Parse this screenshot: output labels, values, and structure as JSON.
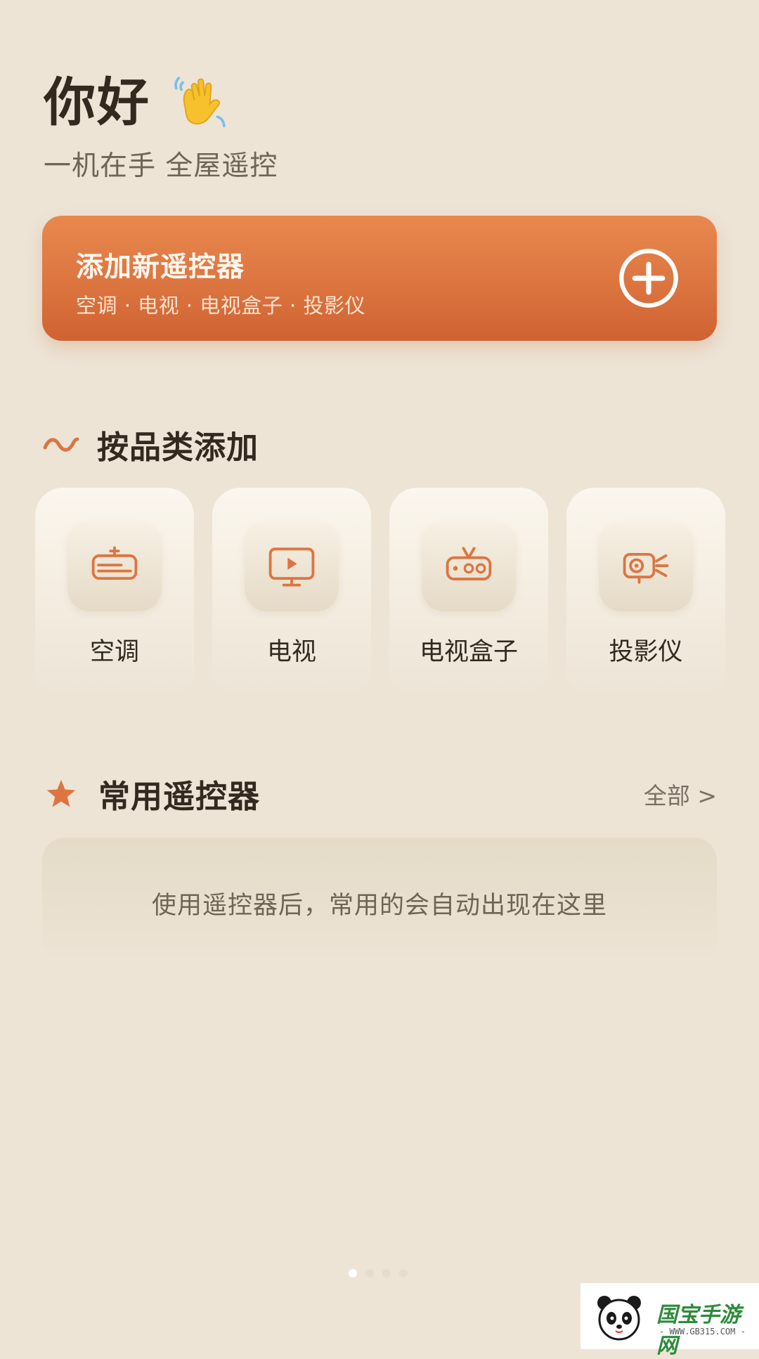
{
  "header": {
    "greeting": "你好",
    "greeting_icon": "waving-hand-icon",
    "subtitle": "一机在手 全屋遥控"
  },
  "add_card": {
    "title": "添加新遥控器",
    "subtitle": "空调 · 电视 · 电视盒子 · 投影仪",
    "icon": "plus-circle-icon"
  },
  "category_section": {
    "title": "按品类添加",
    "icon": "squiggle-icon",
    "items": [
      {
        "label": "空调",
        "icon": "air-conditioner-icon"
      },
      {
        "label": "电视",
        "icon": "tv-icon"
      },
      {
        "label": "电视盒子",
        "icon": "tv-box-icon"
      },
      {
        "label": "投影仪",
        "icon": "projector-icon"
      }
    ]
  },
  "favorites_section": {
    "title": "常用遥控器",
    "icon": "star-icon",
    "see_all": "全部 >",
    "empty_message": "使用遥控器后，常用的会自动出现在这里"
  },
  "pager": {
    "page_count": 4,
    "active_page": 1
  },
  "watermark": {
    "text": "国宝手游网",
    "sub": "- WWW.GB315.COM -"
  },
  "colors": {
    "background": "#ede4d6",
    "accent": "#dc7540",
    "text_primary": "#33291f",
    "text_secondary": "#6f6455"
  }
}
